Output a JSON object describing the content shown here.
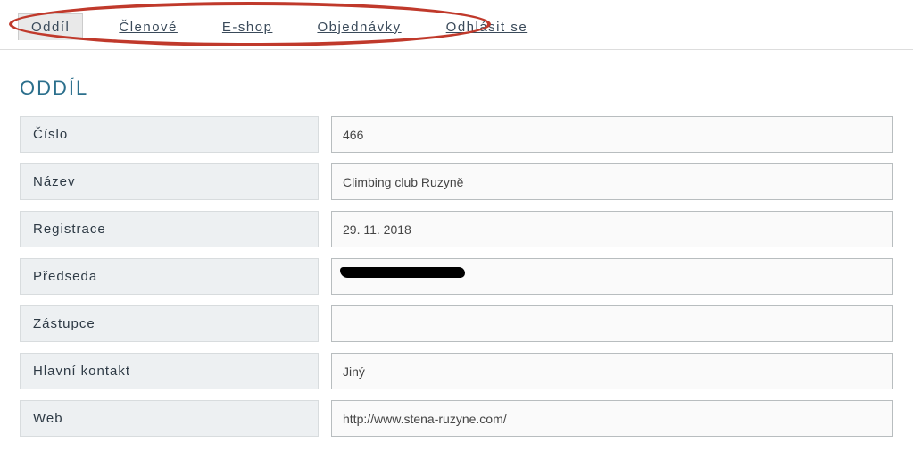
{
  "nav": {
    "tabs": [
      {
        "label": "Oddíl",
        "active": true
      },
      {
        "label": "Členové",
        "active": false
      },
      {
        "label": "E-shop",
        "active": false
      },
      {
        "label": "Objednávky",
        "active": false
      },
      {
        "label": "Odhlásit se",
        "active": false
      }
    ]
  },
  "page": {
    "title": "ODDÍL"
  },
  "form": {
    "fields": [
      {
        "label": "Číslo",
        "value": "466"
      },
      {
        "label": "Název",
        "value": "Climbing club Ruzyně"
      },
      {
        "label": "Registrace",
        "value": "29. 11. 2018"
      },
      {
        "label": "Předseda",
        "value": ""
      },
      {
        "label": "Zástupce",
        "value": ""
      },
      {
        "label": "Hlavní kontakt",
        "value": "Jiný"
      },
      {
        "label": "Web",
        "value": "http://www.stena-ruzyne.com/"
      }
    ]
  },
  "annotation": {
    "ellipse_target": "nav-tabs"
  }
}
